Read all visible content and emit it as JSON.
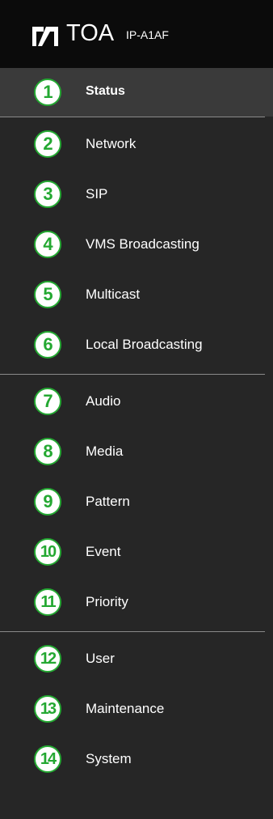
{
  "header": {
    "brand": "TOA",
    "model": "IP-A1AF"
  },
  "nav": {
    "items": [
      {
        "number": "1",
        "label": "Status",
        "active": true
      },
      {
        "number": "2",
        "label": "Network"
      },
      {
        "number": "3",
        "label": "SIP"
      },
      {
        "number": "4",
        "label": "VMS Broadcasting"
      },
      {
        "number": "5",
        "label": "Multicast"
      },
      {
        "number": "6",
        "label": "Local Broadcasting"
      },
      {
        "number": "7",
        "label": "Audio"
      },
      {
        "number": "8",
        "label": "Media"
      },
      {
        "number": "9",
        "label": "Pattern"
      },
      {
        "number": "10",
        "label": "Event"
      },
      {
        "number": "11",
        "label": "Priority"
      },
      {
        "number": "12",
        "label": "User"
      },
      {
        "number": "13",
        "label": "Maintenance"
      },
      {
        "number": "14",
        "label": "System"
      }
    ]
  },
  "colors": {
    "background": "#262626",
    "header_background": "#0b0b0b",
    "active_background": "#3a3a3a",
    "number_badge": "#24a832",
    "divider": "#8a8a8a"
  }
}
